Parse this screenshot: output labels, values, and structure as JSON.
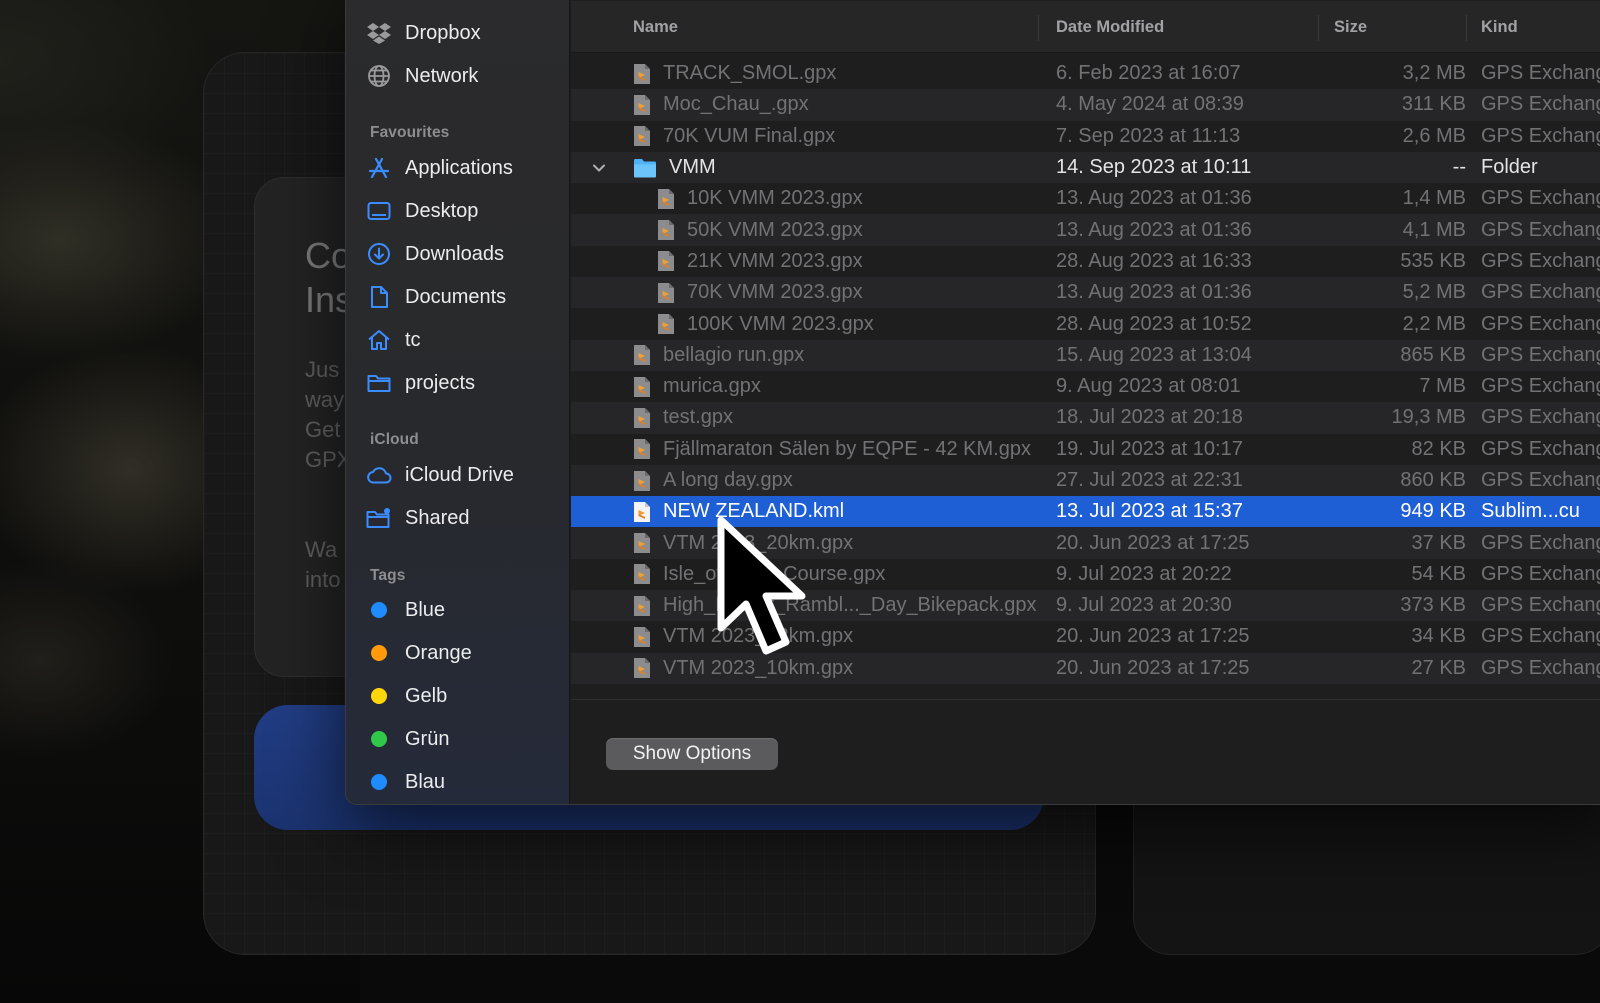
{
  "sidebar": {
    "top_items": [
      {
        "label": "Dropbox",
        "icon": "dropbox-icon"
      },
      {
        "label": "Network",
        "icon": "globe-icon"
      }
    ],
    "favourites_label": "Favourites",
    "favourites": [
      {
        "label": "Applications",
        "icon": "applications-icon"
      },
      {
        "label": "Desktop",
        "icon": "desktop-icon"
      },
      {
        "label": "Downloads",
        "icon": "download-icon"
      },
      {
        "label": "Documents",
        "icon": "document-icon"
      },
      {
        "label": "tc",
        "icon": "home-icon"
      },
      {
        "label": "projects",
        "icon": "folder-icon"
      }
    ],
    "icloud_label": "iCloud",
    "icloud": [
      {
        "label": "iCloud Drive",
        "icon": "cloud-icon"
      },
      {
        "label": "Shared",
        "icon": "shared-folder-icon"
      }
    ],
    "tags_label": "Tags",
    "tags": [
      {
        "label": "Blue",
        "color": "#1e8bff"
      },
      {
        "label": "Orange",
        "color": "#ff9b0a"
      },
      {
        "label": "Gelb",
        "color": "#ffd60a"
      },
      {
        "label": "Grün",
        "color": "#31c84a"
      },
      {
        "label": "Blau",
        "color": "#1e8bff"
      }
    ]
  },
  "columns": {
    "name": "Name",
    "date": "Date Modified",
    "size": "Size",
    "kind": "Kind"
  },
  "files": [
    {
      "name": "TRACK_SMOL.gpx",
      "date": "6. Feb 2023 at 16:07",
      "size": "3,2 MB",
      "kind": "GPS Exchange",
      "type": "file"
    },
    {
      "name": "Moc_Chau_.gpx",
      "date": "4. May 2024 at 08:39",
      "size": "311 KB",
      "kind": "GPS Exchange",
      "type": "file"
    },
    {
      "name": "70K VUM Final.gpx",
      "date": "7. Sep 2023 at 11:13",
      "size": "2,6 MB",
      "kind": "GPS Exchange",
      "type": "file"
    },
    {
      "name": "VMM",
      "date": "14. Sep 2023 at 10:11",
      "size": "--",
      "kind": "Folder",
      "type": "folder"
    },
    {
      "name": "10K VMM 2023.gpx",
      "date": "13. Aug 2023 at 01:36",
      "size": "1,4 MB",
      "kind": "GPS Exchange",
      "type": "child"
    },
    {
      "name": "50K VMM 2023.gpx",
      "date": "13. Aug 2023 at 01:36",
      "size": "4,1 MB",
      "kind": "GPS Exchange",
      "type": "child"
    },
    {
      "name": "21K VMM 2023.gpx",
      "date": "28. Aug 2023 at 16:33",
      "size": "535 KB",
      "kind": "GPS Exchange",
      "type": "child"
    },
    {
      "name": "70K VMM 2023.gpx",
      "date": "13. Aug 2023 at 01:36",
      "size": "5,2 MB",
      "kind": "GPS Exchange",
      "type": "child"
    },
    {
      "name": "100K VMM 2023.gpx",
      "date": "28. Aug 2023 at 10:52",
      "size": "2,2 MB",
      "kind": "GPS Exchange",
      "type": "child"
    },
    {
      "name": "bellagio run.gpx",
      "date": "15. Aug 2023 at 13:04",
      "size": "865 KB",
      "kind": "GPS Exchange",
      "type": "file"
    },
    {
      "name": "murica.gpx",
      "date": "9. Aug 2023 at 08:01",
      "size": "7 MB",
      "kind": "GPS Exchange",
      "type": "file"
    },
    {
      "name": "test.gpx",
      "date": "18. Jul 2023 at 20:18",
      "size": "19,3 MB",
      "kind": "GPS Exchange",
      "type": "file"
    },
    {
      "name": "Fjällmaraton Sälen by EQPE - 42 KM.gpx",
      "date": "19. Jul 2023 at 10:17",
      "size": "82 KB",
      "kind": "GPS Exchange",
      "type": "file"
    },
    {
      "name": "A long day.gpx",
      "date": "27. Jul 2023 at 22:31",
      "size": "860 KB",
      "kind": "GPS Exchange",
      "type": "file"
    },
    {
      "name": "NEW ZEALAND.kml",
      "date": "13. Jul 2023 at 15:37",
      "size": "949 KB",
      "kind": "Sublim...cu",
      "type": "selected"
    },
    {
      "name": "VTM 2023_20km.gpx",
      "date": "20. Jun 2023 at 17:25",
      "size": "37 KB",
      "kind": "GPS Exchange",
      "type": "file"
    },
    {
      "name": "Isle_of_Man_Course.gpx",
      "date": "9. Jul 2023 at 20:22",
      "size": "54 KB",
      "kind": "GPS Exchange",
      "type": "file"
    },
    {
      "name": "High_Desert_Rambl..._Day_Bikepack.gpx",
      "date": "9. Jul 2023 at 20:30",
      "size": "373 KB",
      "kind": "GPS Exchange",
      "type": "file"
    },
    {
      "name": "VTM 2023_42km.gpx",
      "date": "20. Jun 2023 at 17:25",
      "size": "34 KB",
      "kind": "GPS Exchange",
      "type": "file"
    },
    {
      "name": "VTM 2023_10km.gpx",
      "date": "20. Jun 2023 at 17:25",
      "size": "27 KB",
      "kind": "GPS Exchange",
      "type": "file"
    }
  ],
  "show_options_label": "Show Options",
  "background": {
    "heading_fragment": "Co\nIns",
    "paragraph_fragment": "Jus\nway\nGet\nGPX",
    "paragraph2_fragment": "Wa\ninto"
  }
}
